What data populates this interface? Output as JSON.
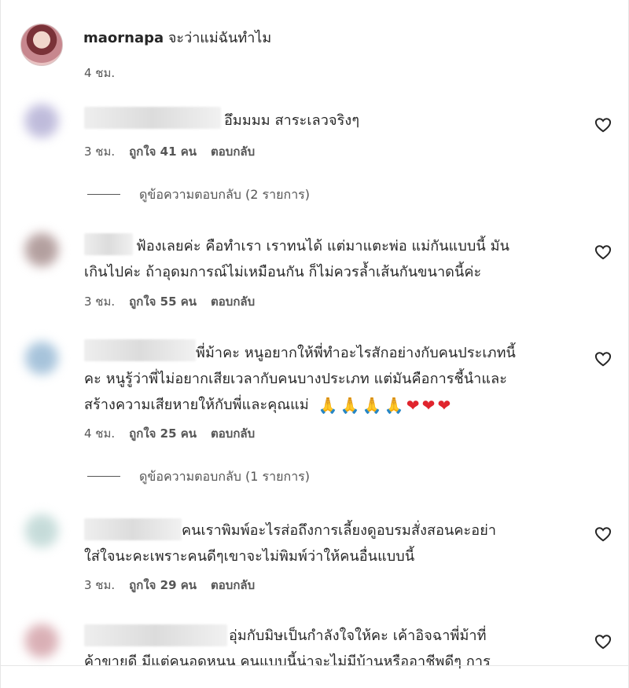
{
  "top_comment": {
    "username": "maornapa",
    "text": "จะว่าแม่ฉันทำไม",
    "time": "4 ชม."
  },
  "comments": [
    {
      "text_lines": [
        "อึมมมม สาระเลวจริงๆ"
      ],
      "time": "3 ชม.",
      "likes": "ถูกใจ 41 คน",
      "reply": "ตอบกลับ",
      "view_replies": "ดูข้อความตอบกลับ (2 รายการ)"
    },
    {
      "text_lines": [
        "ฟ้องเลยค่ะ คือทำเรา เราทนได้ แต่มาแตะพ่อ แม่กันแบบนี้ มัน",
        "เกินไปค่ะ ถ้าอุดมการณ์ไม่เหมือนกัน ก็ไม่ควรล้ำเส้นกันขนาดนี้ค่ะ"
      ],
      "time": "3 ชม.",
      "likes": "ถูกใจ 55 คน",
      "reply": "ตอบกลับ"
    },
    {
      "text_lines": [
        "พี่ม้าคะ หนูอยากให้พี่ทำอะไรสักอย่างกับคนประเภทนี้",
        "คะ หนูรู้ว่าพี่ไม่อยากเสียเวลากับคนบางประเภท แต่มันคือการชี้นำและ",
        "สร้างความเสียหายให้กับพี่และคุณแม่"
      ],
      "emojis": [
        "🙏",
        "🙏",
        "🙏",
        "🙏",
        "❤",
        "❤",
        "❤"
      ],
      "time": "4 ชม.",
      "likes": "ถูกใจ 25 คน",
      "reply": "ตอบกลับ",
      "view_replies": "ดูข้อความตอบกลับ (1 รายการ)"
    },
    {
      "text_lines": [
        "คนเราพิมพ์อะไรส่อถึงการเลี้ยงดูอบรมสั่งสอนคะอย่า",
        "ใส่ใจนะคะเพราะคนดีๆเขาจะไม่พิมพ์ว่าให้คนอื่นแบบนี้"
      ],
      "time": "3 ชม.",
      "likes": "ถูกใจ 29 คน",
      "reply": "ตอบกลับ"
    },
    {
      "text_lines": [
        "อุ่มกับมิษเป็นกำลังใจให้คะ เค้าอิจฉาพี่ม้าที่",
        "ค้าขายดี มีแต่คนอดหนน คนแบบนี้น่าจะไม่มีบ้านหรืออาชีพดีๆ การ"
      ]
    }
  ],
  "colors": {
    "text": "#262626",
    "meta": "#555555",
    "heart": "#e0242d",
    "background": "#ffffff"
  },
  "icons": {
    "like": "heart-outline-icon",
    "avatar": "profile-avatar"
  }
}
